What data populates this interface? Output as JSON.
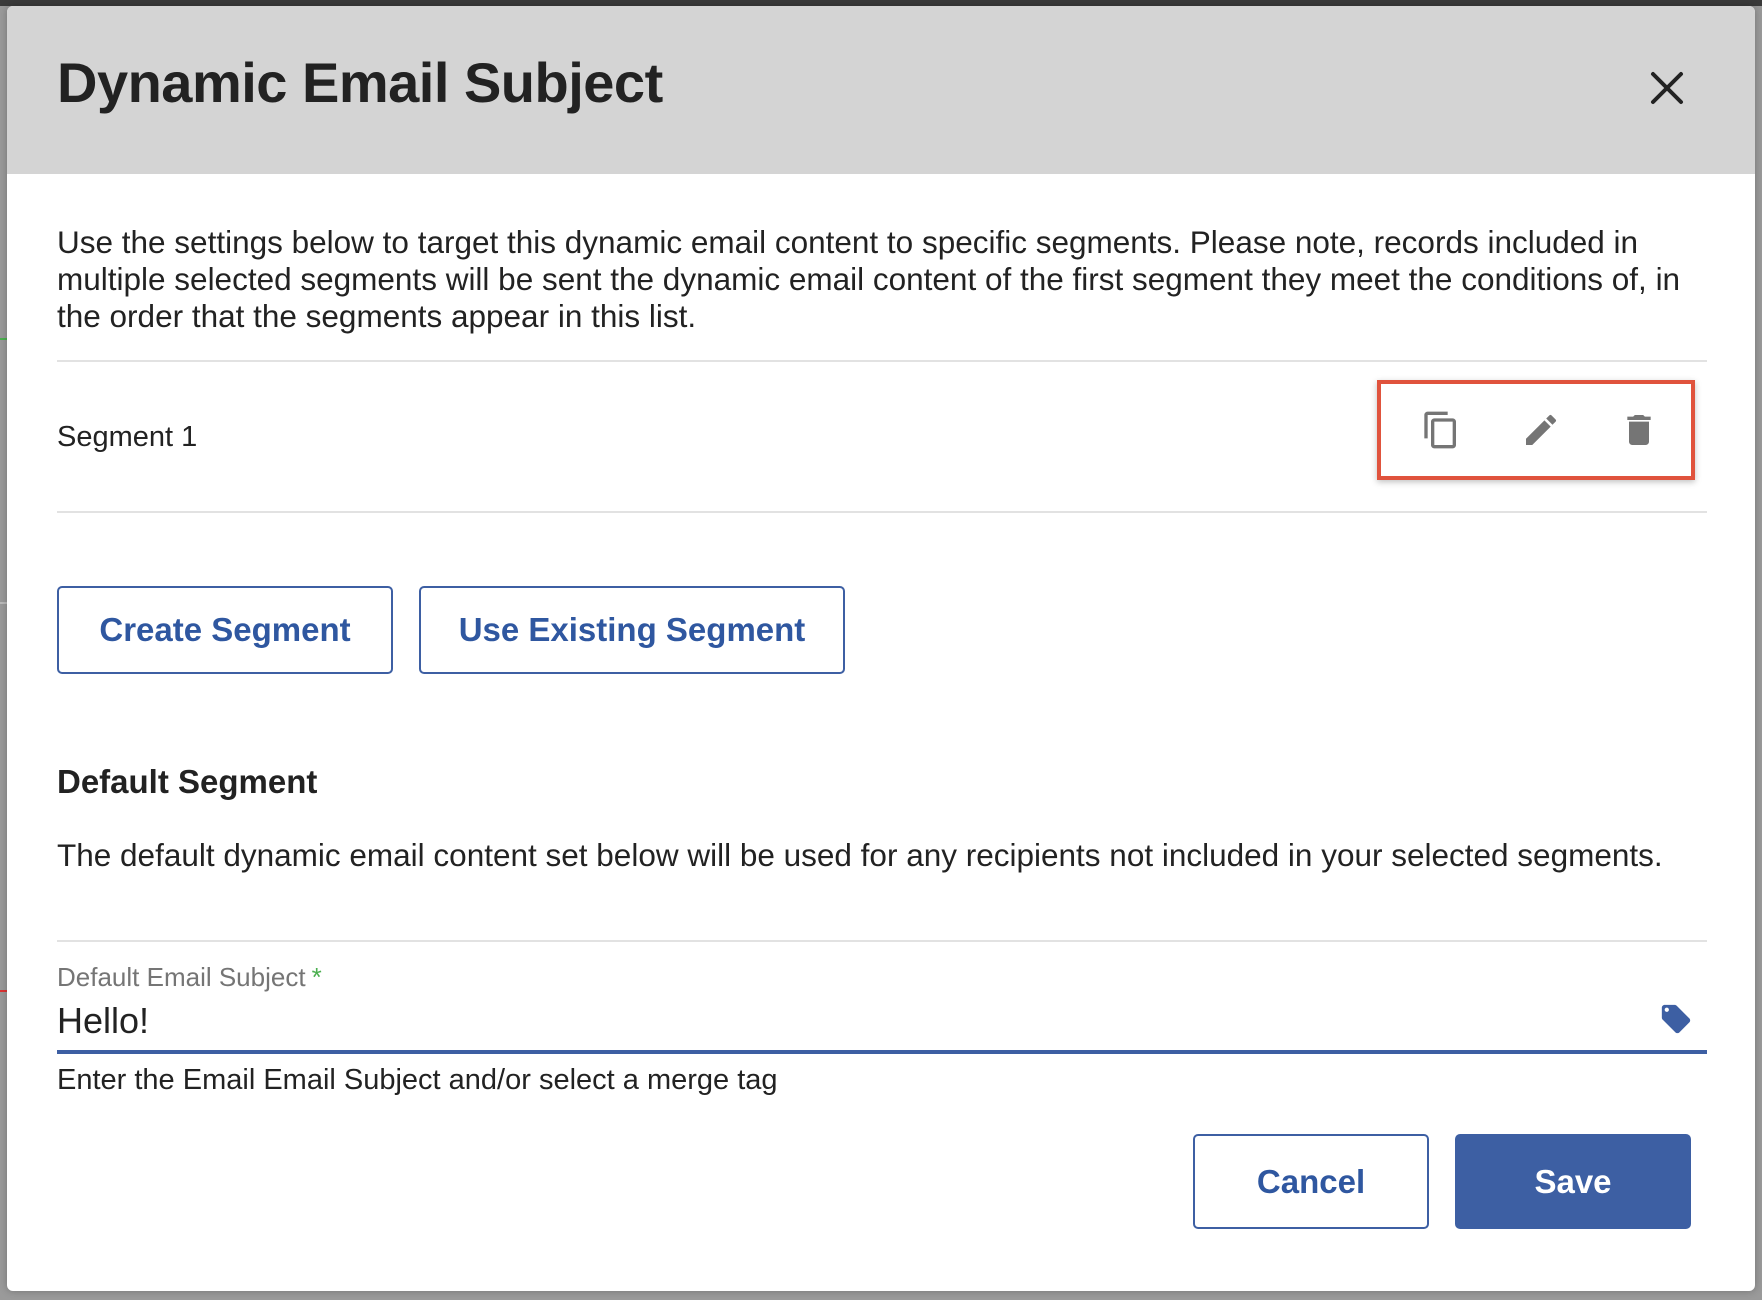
{
  "modal": {
    "title": "Dynamic Email Subject",
    "description": "Use the settings below to target this dynamic email content to specific segments. Please note, records included in multiple selected segments will be sent the dynamic email content of the first segment they meet the conditions of, in the order that the segments appear in this list."
  },
  "segments": [
    {
      "name": "Segment 1",
      "actions": [
        {
          "icon": "copy-icon"
        },
        {
          "icon": "edit-icon"
        },
        {
          "icon": "delete-icon"
        }
      ]
    }
  ],
  "segment_buttons": {
    "create_label": "Create Segment",
    "use_existing_label": "Use Existing Segment"
  },
  "default_segment": {
    "heading": "Default Segment",
    "description": "The default dynamic email content set below will be used for any recipients not included in your selected segments.",
    "field_label": "Default Email Subject",
    "required_marker": "*",
    "field_value": "Hello!",
    "merge_tag_icon": "tag-icon",
    "helper_text": "Enter the Email Email Subject and/or select a merge tag"
  },
  "footer": {
    "cancel_label": "Cancel",
    "save_label": "Save"
  },
  "colors": {
    "accent": "#3d5fa3",
    "header_bg": "#d4d4d4",
    "highlight_border": "#e0533d",
    "required": "#4caf50"
  }
}
